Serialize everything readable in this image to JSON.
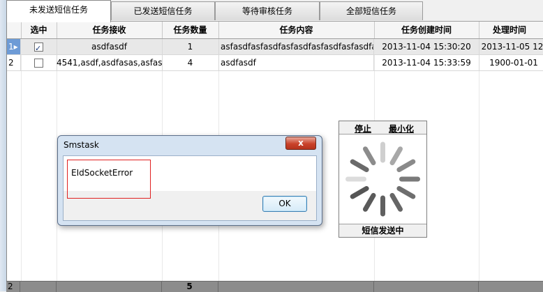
{
  "tabs": [
    {
      "label": "未发送短信任务"
    },
    {
      "label": "已发送短信任务"
    },
    {
      "label": "等待审核任务"
    },
    {
      "label": "全部短信任务"
    }
  ],
  "grid": {
    "columns": [
      "选中",
      "任务接收",
      "任务数量",
      "任务内容",
      "任务创建时间",
      "处理时间"
    ],
    "rows": [
      {
        "index": "1",
        "checked": true,
        "receiver": "asdfasdf",
        "count": "1",
        "content": "asfasdfasfasdfasfasdfasfasdfasfasdfasfasdfasfasdfasfasdf",
        "created": "2013-11-04 15:30:20",
        "processed": "2013-11-05 12:"
      },
      {
        "index": "2",
        "checked": false,
        "receiver": "4541,asdf,asdfasas,asfas",
        "count": "4",
        "content": "asdfasdf",
        "created": "2013-11-04 15:33:59",
        "processed": "1900-01-01"
      }
    ]
  },
  "footer": {
    "row_count": "2",
    "total": "5"
  },
  "dialog": {
    "title": "Smstask",
    "message": "EIdSocketError",
    "ok_label": "OK",
    "close_label": "x"
  },
  "widget": {
    "stop_label": "停止",
    "minimize_label": "最小化",
    "status_label": "短信发送中"
  },
  "colors": {
    "selection": "#6d9bd6",
    "error_highlight": "#e02020"
  }
}
